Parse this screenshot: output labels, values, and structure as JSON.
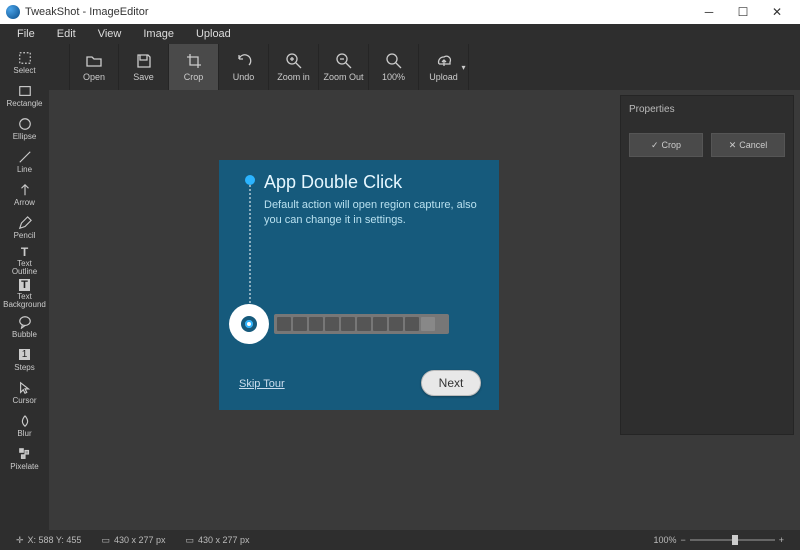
{
  "titlebar": {
    "title": "TweakShot - ImageEditor"
  },
  "menu": {
    "file": "File",
    "edit": "Edit",
    "view": "View",
    "image": "Image",
    "upload": "Upload"
  },
  "toolbar": {
    "open": "Open",
    "save": "Save",
    "crop": "Crop",
    "undo": "Undo",
    "zoom_in": "Zoom in",
    "zoom_out": "Zoom Out",
    "p100": "100%",
    "upload": "Upload"
  },
  "tools": {
    "select": "Select",
    "rectangle": "Rectangle",
    "ellipse": "Ellipse",
    "line": "Line",
    "arrow": "Arrow",
    "pencil": "Pencil",
    "text_outline": "Text\nOutline",
    "text_background": "Text\nBackground",
    "bubble": "Bubble",
    "steps": "Steps",
    "cursor": "Cursor",
    "blur": "Blur",
    "pixelate": "Pixelate"
  },
  "properties": {
    "title": "Properties",
    "crop": "Crop",
    "cancel": "Cancel"
  },
  "onboard": {
    "title": "App Double Click",
    "desc": "Default action will open region capture, also you can change it in settings.",
    "skip": "Skip Tour",
    "next": "Next"
  },
  "status": {
    "coords": "X: 588 Y: 455",
    "dim1": "430 x 277 px",
    "dim2": "430 x 277 px",
    "zoom": "100%"
  }
}
